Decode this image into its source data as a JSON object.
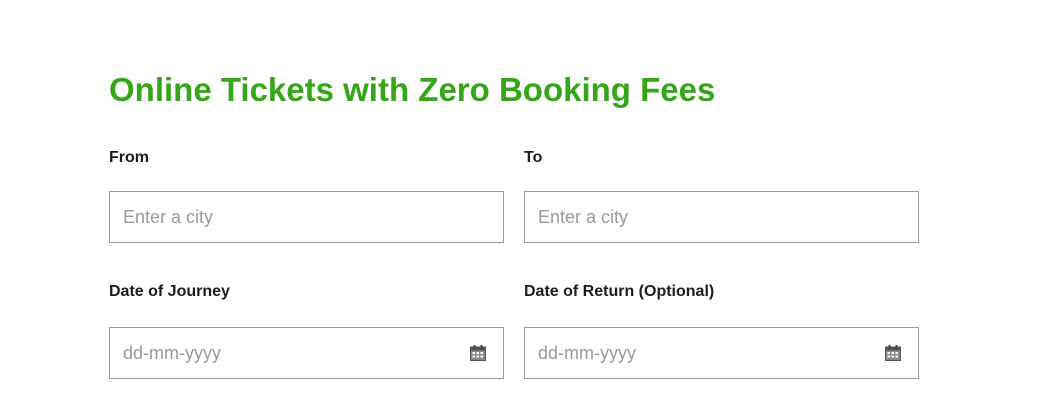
{
  "page": {
    "title": "Online Tickets with Zero Booking Fees"
  },
  "colors": {
    "title": "#34a617",
    "label": "#1c1c1c",
    "input_border": "#9a9a9a",
    "placeholder": "#9a9a9a"
  },
  "form": {
    "from": {
      "label": "From",
      "placeholder": "Enter a city",
      "value": ""
    },
    "to": {
      "label": "To",
      "placeholder": "Enter a city",
      "value": ""
    },
    "date_of_journey": {
      "label": "Date of Journey",
      "placeholder": "dd-mm-yyyy",
      "value": "",
      "icon": "calendar-icon"
    },
    "date_of_return": {
      "label": "Date of Return (Optional)",
      "placeholder": "dd-mm-yyyy",
      "value": "",
      "icon": "calendar-icon"
    }
  }
}
